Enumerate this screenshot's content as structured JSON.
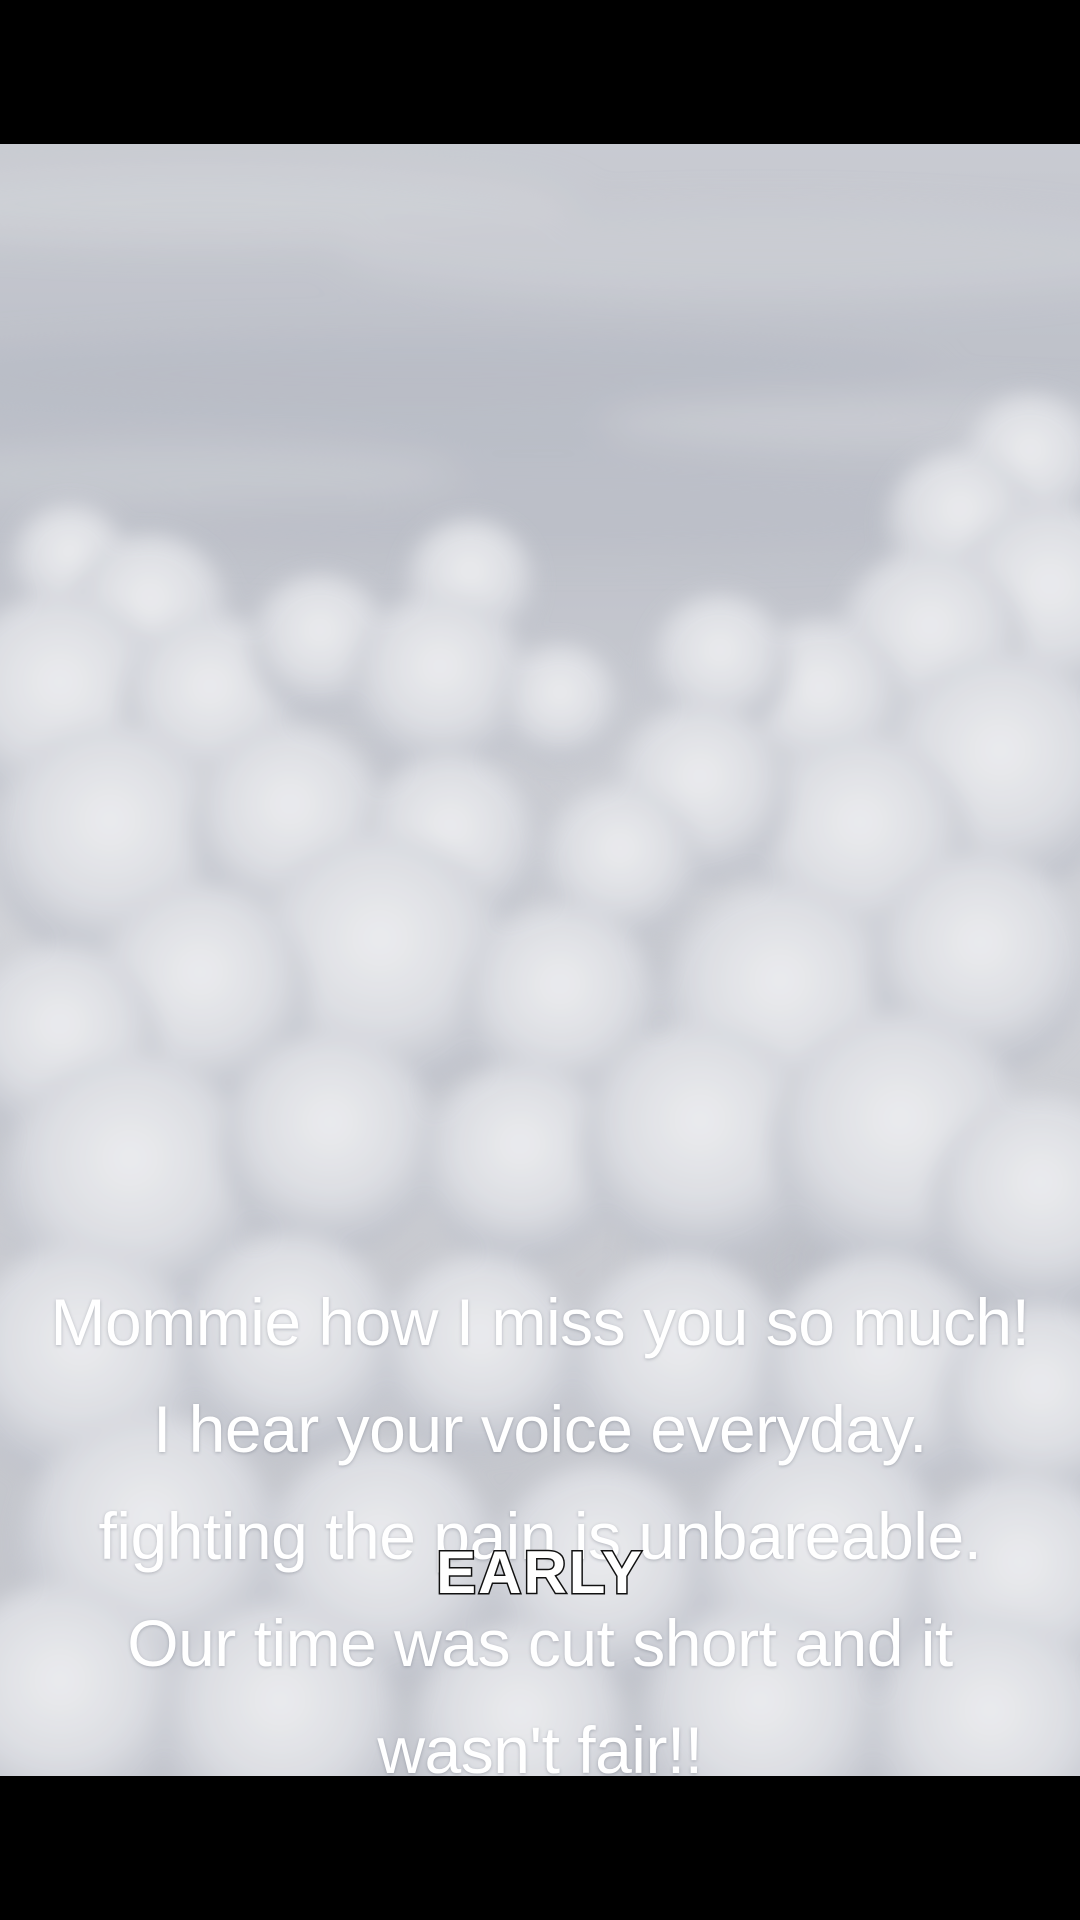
{
  "video": {
    "caption": "Mommie how I miss you so much! I hear your voice everyday. fighting the pain is unbareable. Our time was cut short and it wasn't fair!!",
    "overlay_word": "EARLY"
  },
  "colors": {
    "letterbox": "#000000",
    "sky": "#c3c6ce",
    "cloud": "#f2f3f5",
    "caption_text": "#ffffff",
    "overlay_stroke": "#111111"
  }
}
